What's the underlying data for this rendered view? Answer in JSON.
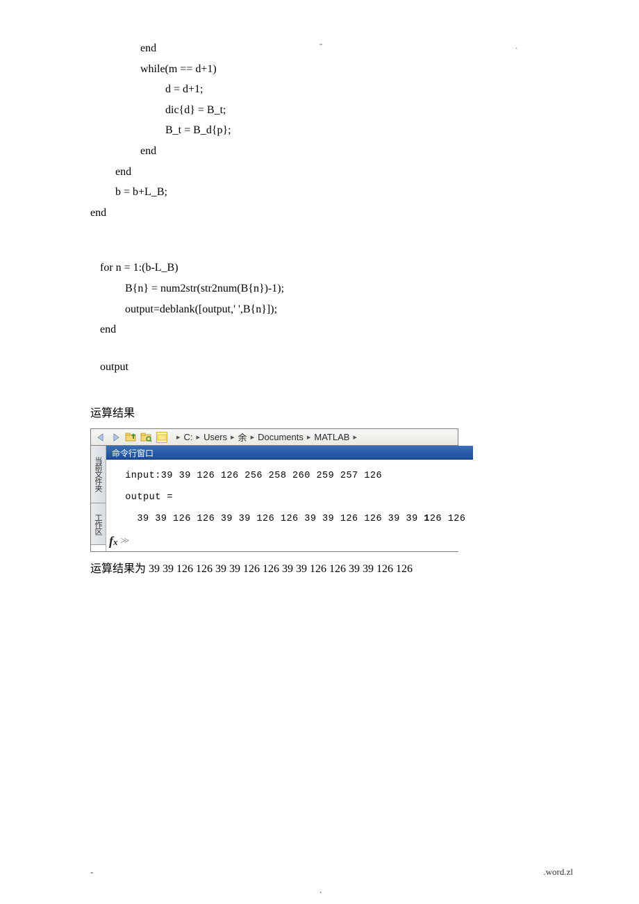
{
  "code": {
    "l1": "end",
    "l2": "while(m == d+1)",
    "l3": "d = d+1;",
    "l4": "dic{d} = B_t;",
    "l5": "B_t = B_d{p};",
    "l6": "end",
    "l7": "end",
    "l8": "b = b+L_B;",
    "l9": "end",
    "l10": "for n = 1:(b-L_B)",
    "l11": "B{n} = num2str(str2num(B{n})-1);",
    "l12": "output=deblank([output,' ',B{n}]);",
    "l13": "end",
    "l14": "output"
  },
  "result_heading": "运算结果",
  "matlab": {
    "breadcrumb": {
      "p1": "C:",
      "p2": "Users",
      "p3": "余",
      "p4": "Documents",
      "p5": "MATLAB"
    },
    "side_tab_1": "当前文件夹",
    "side_tab_2": "工作区",
    "cmd_title": "命令行窗口",
    "line1": "  input:39 39 126 126 256 258 260 259 257 126",
    "line2": "  output =",
    "line3_a": "    39 39 126 126 39 39 126 126 39 39 126 126 39 39 ",
    "line3_b": "1",
    "line3_c": "26 126",
    "prompt": ">>"
  },
  "result_text_prefix": "运算结果为 ",
  "result_text_values": "39 39 126 126 39 39 126 126 39 39 126 126 39 39 126 126",
  "footer": {
    "left": "-",
    "right": ".word.zl",
    "center": "."
  },
  "decor": {
    "top1": "-",
    "top2": "."
  }
}
